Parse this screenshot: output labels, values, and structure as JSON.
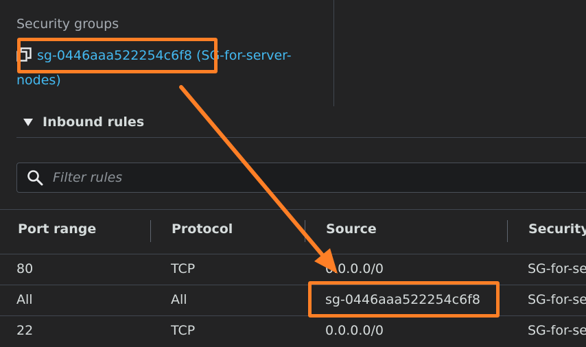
{
  "security_groups": {
    "label": "Security groups",
    "link_text": "sg-0446aaa522254c6f8 (SG-for-server-nodes)",
    "copy_icon": "copy-icon"
  },
  "inbound_rules": {
    "title": "Inbound rules",
    "filter_placeholder": "Filter rules"
  },
  "table": {
    "columns": [
      "Port range",
      "Protocol",
      "Source",
      "Security"
    ],
    "rows": [
      {
        "port": "80",
        "protocol": "TCP",
        "source": "0.0.0.0/0",
        "security": "SG-for-se"
      },
      {
        "port": "All",
        "protocol": "All",
        "source": "sg-0446aaa522254c6f8",
        "security": "SG-for-se"
      },
      {
        "port": "22",
        "protocol": "TCP",
        "source": "0.0.0.0/0",
        "security": "SG-for-se"
      }
    ]
  },
  "colors": {
    "background": "#232324",
    "link": "#44b9f0",
    "highlight": "#ff7f26",
    "text": "#d5dbdb"
  }
}
